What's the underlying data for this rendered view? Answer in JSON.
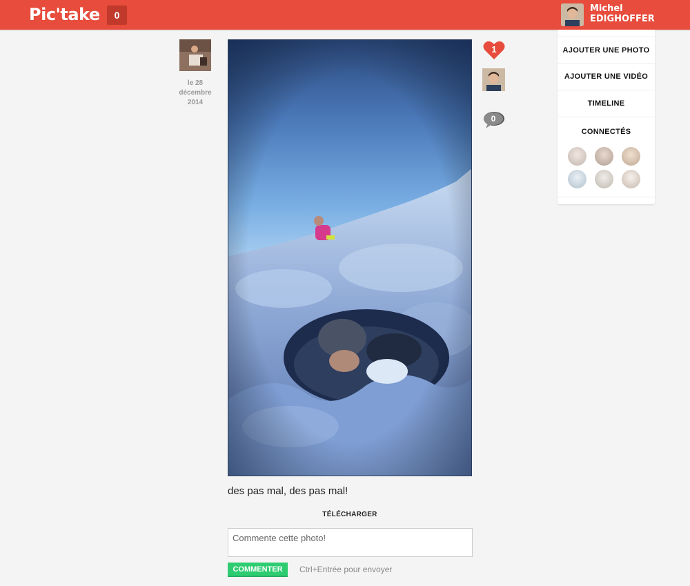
{
  "header": {
    "brand": "Pic'take",
    "notification_count": "0",
    "user_first_name": "Michel",
    "user_last_name": "EDIGHOFFER"
  },
  "post": {
    "date_line1": "le 28",
    "date_line2": "décembre",
    "date_line3": "2014",
    "likes": "1",
    "comments": "0",
    "caption": "des pas mal, des pas mal!",
    "download_label": "TÉLÉCHARGER",
    "comment_placeholder": "Commente cette photo!",
    "comment_button": "COMMENTER",
    "comment_hint": "Ctrl+Entrée pour envoyer"
  },
  "sidebar": {
    "items": [
      {
        "label": "AJOUTER UNE PHOTO"
      },
      {
        "label": "AJOUTER UNE VIDÉO"
      },
      {
        "label": "TIMELINE"
      }
    ],
    "connected_title": "CONNECTÉS"
  },
  "colors": {
    "brand": "#e74c3c",
    "notif_bg": "#c0392b",
    "comment_button": "#2ecc71"
  }
}
